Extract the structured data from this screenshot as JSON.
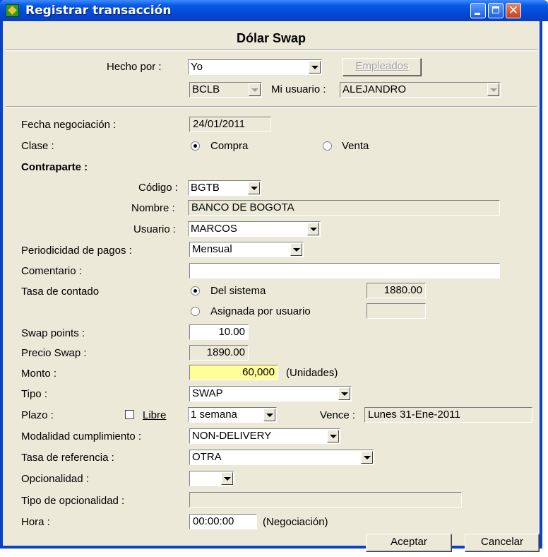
{
  "window": {
    "title": "Registrar transacción"
  },
  "form": {
    "heading": "Dólar Swap",
    "hecho_por": {
      "label": "Hecho por :",
      "value": "Yo"
    },
    "empleados_button": "Empleados",
    "entity": {
      "value": "BCLB"
    },
    "mi_usuario": {
      "label": "Mi usuario :",
      "value": "ALEJANDRO"
    },
    "fecha": {
      "label": "Fecha negociación :",
      "value": "24/01/2011"
    },
    "clase": {
      "label": "Clase :",
      "compra": "Compra",
      "venta": "Venta",
      "selected": "Compra"
    },
    "contraparte": {
      "label": "Contraparte :",
      "codigo": {
        "label": "Código :",
        "value": "BGTB"
      },
      "nombre": {
        "label": "Nombre :",
        "value": "BANCO DE BOGOTA"
      },
      "usuario": {
        "label": "Usuario :",
        "value": "MARCOS"
      }
    },
    "periodicidad": {
      "label": "Periodicidad de pagos :",
      "value": "Mensual"
    },
    "comentario": {
      "label": "Comentario :",
      "value": ""
    },
    "tasa_contado": {
      "label": "Tasa de contado",
      "del_sistema": "Del sistema",
      "sistema_value": "1880.00",
      "asignada": "Asignada por usuario",
      "asignada_value": "",
      "selected": "Del sistema"
    },
    "swap_points": {
      "label": "Swap points :",
      "value": "10.00"
    },
    "precio_swap": {
      "label": "Precio Swap :",
      "value": "1890.00"
    },
    "monto": {
      "label": "Monto :",
      "value": "60,000",
      "unit": "(Unidades)"
    },
    "tipo": {
      "label": "Tipo :",
      "value": "SWAP"
    },
    "plazo": {
      "label": "Plazo :",
      "libre": "Libre",
      "libre_checked": false,
      "value": "1 semana",
      "vence_label": "Vence :",
      "vence_value": "Lunes 31-Ene-2011"
    },
    "modalidad": {
      "label": "Modalidad cumplimiento :",
      "value": "NON-DELIVERY"
    },
    "tasa_referencia": {
      "label": "Tasa de referencia :",
      "value": "OTRA"
    },
    "opcionalidad": {
      "label": "Opcionalidad :",
      "value": ""
    },
    "tipo_opcionalidad": {
      "label": "Tipo de opcionalidad :",
      "value": ""
    },
    "hora": {
      "label": "Hora :",
      "value": "00:00:00",
      "note": "(Negociación)"
    },
    "aceptar_button": "Aceptar",
    "cancelar_button": "Cancelar"
  },
  "colors": {
    "titlebar": "#0a5ae5",
    "dialog_bg": "#ece9d8",
    "monto_highlight": "#ffff99",
    "close_button": "#c6401c"
  }
}
